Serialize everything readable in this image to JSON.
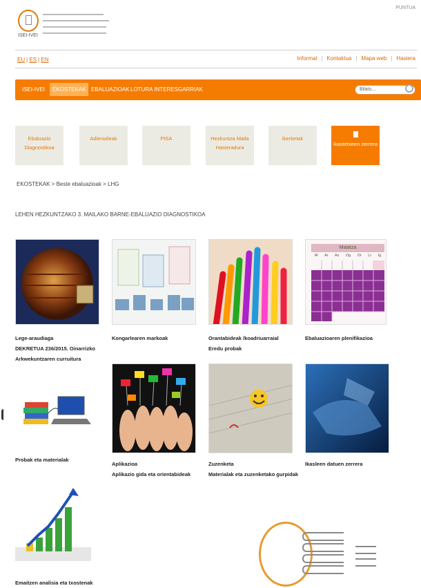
{
  "header": {
    "logo_text": "ISEI-IVEI",
    "partner": "PUNTUA"
  },
  "lang_links": [
    "EU",
    "ES",
    "EN"
  ],
  "top_links": [
    "Informal",
    "Kontaktua",
    "Mapa web",
    "Hasiera"
  ],
  "nav": {
    "items": [
      "ISEI-IVEI",
      "EKOSTEKAK",
      "EBALUAZIOAK",
      "LOTURA INTERESGARRIAK"
    ],
    "active": "EKOSTEKAK",
    "search_placeholder": "Bilatu..."
  },
  "tiles": [
    {
      "label": "Ebaluazio Diagnostikoa"
    },
    {
      "label": "Adierazleak"
    },
    {
      "label": "PISA"
    },
    {
      "label": "Hezkuntza Maila Hasieradura"
    },
    {
      "label": "Ikerketak"
    },
    {
      "label": "Ikastetxeen zerrera",
      "icon": "document-icon"
    }
  ],
  "breadcrumb": "EKOSTEKAK > Beste ebaluazioak > LHG",
  "section_title": "LEHEN HEZKUNTZAKO 3. MAILAKO BARNE-EBALUAZIO DIAGNOSTIKOA",
  "cards": [
    {
      "image": "book-globe",
      "caption": [
        "Lege-araudiaga",
        "DEKRETUA 236/2015. Oinarrizko",
        "Arkwekuntzaren curruitura"
      ]
    },
    {
      "image": "framework-diagram",
      "caption": [
        "Kongarlearen markoak"
      ]
    },
    {
      "image": "colored-pencils",
      "caption": [
        "Orantabideak /koadriuarraial",
        "Eredu probak"
      ]
    },
    {
      "image": "calendar",
      "caption": [
        "Ebaluazioaren plenifikazioa"
      ],
      "calendar": {
        "month": "Maiatza",
        "days": [
          "Al",
          "Ar",
          "Az",
          "Og",
          "Or",
          "Lr",
          "Ig"
        ]
      }
    },
    {
      "image": "books-laptop",
      "caption": [
        "Probak eta materialak"
      ]
    },
    {
      "image": "raised-hands",
      "caption": [
        "Aplikazioa",
        "Aplikazio gida eta orientabideak"
      ]
    },
    {
      "image": "smiley-paper",
      "caption": [
        "Zuzenketa",
        "Materialak eta zuzenketako gurpidak"
      ]
    },
    {
      "image": "blue-hand",
      "caption": [
        "Ikasleen datuen zerrera"
      ]
    },
    {
      "image": "growth-chart",
      "caption": [
        "Emaitzen analisia eta txostenak"
      ]
    }
  ],
  "colors": {
    "accent": "#f57c00",
    "tile_bg": "#ecebe3",
    "active_tab": "#ffb155"
  }
}
